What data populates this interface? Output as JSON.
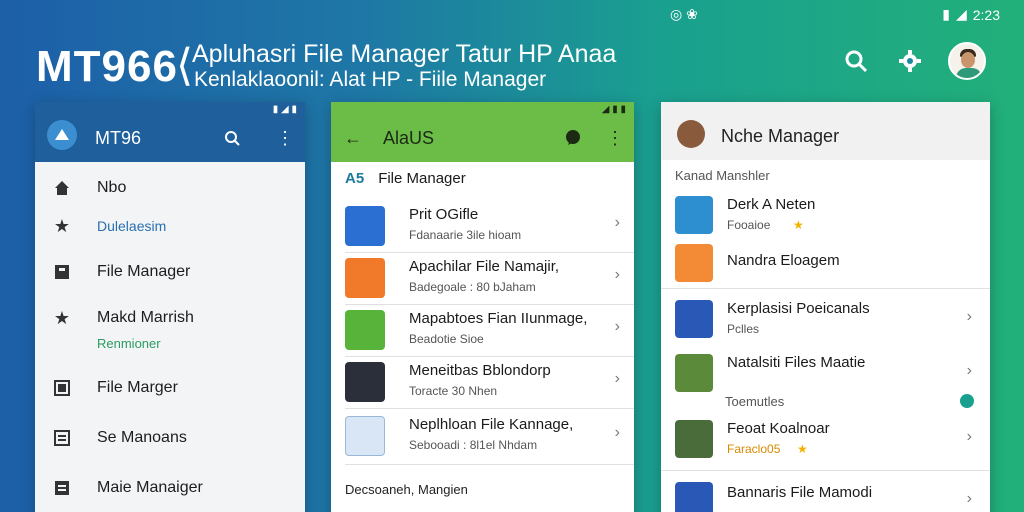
{
  "status_top": {
    "left_icons": "◎ ❀",
    "time": "2:23"
  },
  "hero": {
    "title": "MT966",
    "bracket": "⟨",
    "subtitle1": "Apluhasri File Manager Tatur HP Anaa",
    "subtitle2": "Kenlaklaoonil: Alat HP - Fiile Manager"
  },
  "panel1": {
    "title": "MT96",
    "items": [
      {
        "label": "Nbo"
      },
      {
        "label": "Dulelaesim"
      },
      {
        "label": "File Manager"
      },
      {
        "label": "Makd Marrish",
        "sub": "Renmioner"
      },
      {
        "label": "File Marger"
      },
      {
        "label": "Se Manoans"
      },
      {
        "label": "Maie Manaiger"
      }
    ]
  },
  "panel2": {
    "title": "AlaUS",
    "section": "File Manager",
    "section_badge": "A5",
    "rows": [
      {
        "title": "Prit OGifle",
        "sub": "Fdanaarie 3ile hioam"
      },
      {
        "title": "Apachilar File Namajir,",
        "sub": "Badegoale : 80 bJaham"
      },
      {
        "title": "Mapabtoes Fian IIunmage,",
        "sub": "Beadotie Sioe"
      },
      {
        "title": "Meneitbas Bblondorp",
        "sub": "Toracte 30 Nhen"
      },
      {
        "title": "Neplhloan File Kannage,",
        "sub": "Sebooadi : 8l1el Nhdam"
      }
    ],
    "footer": "Decsoaneh, Mangien"
  },
  "panel3": {
    "title": "Nche Manager",
    "section1": "Kanad Manshler",
    "rows1": [
      {
        "title": "Derk A Neten",
        "sub": "Fooaioe"
      },
      {
        "title": "Nandra Eloagem",
        "sub": ""
      }
    ],
    "rows2": [
      {
        "title": "Kerplasisi Poeicanals",
        "sub": "Pclles"
      },
      {
        "title": "Natalsiti Files Maatie",
        "sub": ""
      }
    ],
    "section2": "Toemutles",
    "rows3": [
      {
        "title": "Feoat Koalnoar",
        "sub": "Faraclo05"
      },
      {
        "title": "Bannaris File Mamodi",
        "sub": ""
      }
    ]
  },
  "colors": {
    "panel1_bar": "#1e5f9c",
    "panel2_bar": "#6bbd48",
    "accent_green": "#2a9b62",
    "star": "#f2b300"
  }
}
